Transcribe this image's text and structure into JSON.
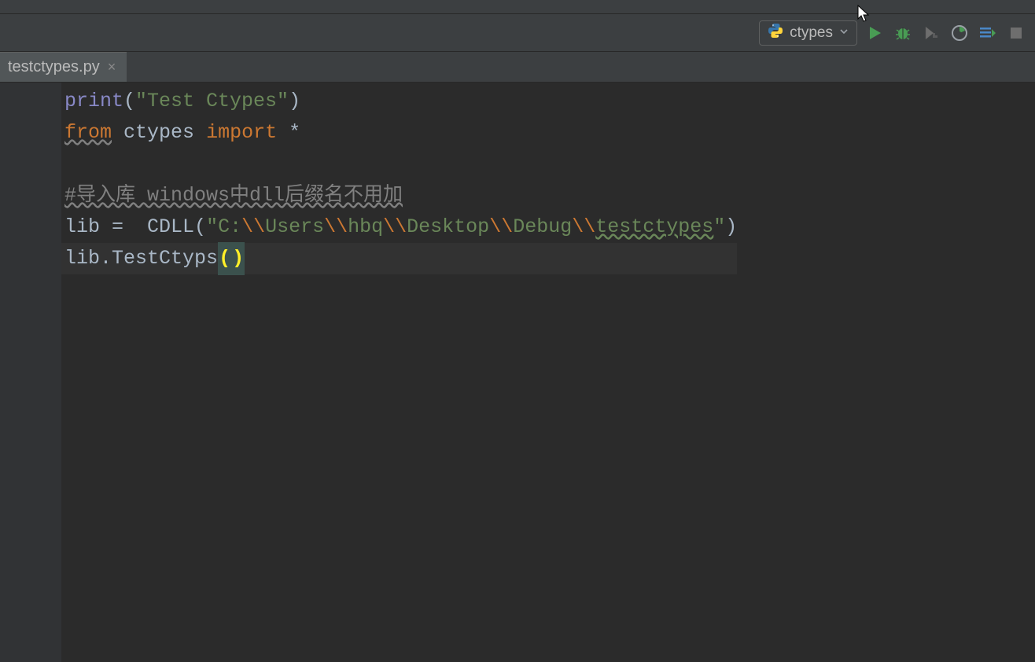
{
  "toolbar": {
    "run_config_label": "ctypes"
  },
  "tabs": {
    "active": {
      "label": "testctypes.py"
    }
  },
  "code": {
    "lines": [
      {
        "tokens": [
          {
            "t": "print",
            "c": "fn"
          },
          {
            "t": "(",
            "c": "lparen"
          },
          {
            "t": "\"Test Ctypes\"",
            "c": "str"
          },
          {
            "t": ")",
            "c": "lparen"
          }
        ]
      },
      {
        "tokens": [
          {
            "t": "from",
            "c": "kw underline-wavy"
          },
          {
            "t": " ",
            "c": ""
          },
          {
            "t": "ctypes",
            "c": "ident"
          },
          {
            "t": " ",
            "c": ""
          },
          {
            "t": "import",
            "c": "kw"
          },
          {
            "t": " *",
            "c": "ident"
          }
        ]
      },
      {
        "tokens": []
      },
      {
        "tokens": [
          {
            "t": "#导入库 windows中dll后缀名不用加",
            "c": "comment underline-wavy"
          }
        ]
      },
      {
        "tokens": [
          {
            "t": "lib",
            "c": "ident"
          },
          {
            "t": " =  ",
            "c": "ident"
          },
          {
            "t": "CDLL",
            "c": "ident"
          },
          {
            "t": "(",
            "c": "lparen"
          },
          {
            "t": "\"C:",
            "c": "str"
          },
          {
            "t": "\\\\",
            "c": "kw"
          },
          {
            "t": "Users",
            "c": "str"
          },
          {
            "t": "\\\\",
            "c": "kw"
          },
          {
            "t": "hbq",
            "c": "str"
          },
          {
            "t": "\\\\",
            "c": "kw"
          },
          {
            "t": "Desktop",
            "c": "str"
          },
          {
            "t": "\\\\",
            "c": "kw"
          },
          {
            "t": "Debug",
            "c": "str"
          },
          {
            "t": "\\\\",
            "c": "kw"
          },
          {
            "t": "testctypes",
            "c": "str underline-green"
          },
          {
            "t": "\"",
            "c": "str"
          },
          {
            "t": ")",
            "c": "lparen"
          }
        ]
      },
      {
        "hl": true,
        "tokens": [
          {
            "t": "lib",
            "c": "ident"
          },
          {
            "t": ".",
            "c": "ident"
          },
          {
            "t": "TestCtyps",
            "c": "member"
          },
          {
            "t": "(",
            "c": "bright-paren",
            "bg": true
          },
          {
            "t": ")",
            "c": "bright-paren",
            "bg": true
          }
        ]
      }
    ]
  }
}
